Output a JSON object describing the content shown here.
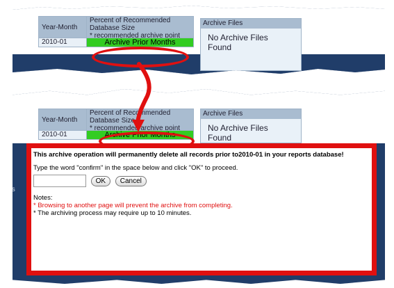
{
  "table": {
    "year_month_header": "Year-Month",
    "percent_header_line1": "Percent of Recommended",
    "percent_header_line2": "Database Size",
    "percent_header_line3": "* recommended archive point",
    "row_month": "2010-01",
    "archive_button": "Archive Prior Months"
  },
  "archive_files": {
    "header": "Archive Files",
    "body": "No Archive Files Found"
  },
  "dialog": {
    "warning": "This archive operation will permanently delete all records prior to2010-01 in your reports database!",
    "instruction": "Type the word \"confirm\" in the space below and click \"OK\" to proceed.",
    "input_value": "",
    "ok_label": "OK",
    "cancel_label": "Cancel",
    "notes_label": "Notes:",
    "note1": "* Browsing to another page will prevent the archive from completing.",
    "note2": "* The archiving process may require up to 10 minutes."
  },
  "side_fragment": "ts",
  "colors": {
    "highlight_red": "#e01010",
    "button_green": "#33cc22",
    "page_navy": "#203d69",
    "header_blue": "#a9bcd0"
  }
}
